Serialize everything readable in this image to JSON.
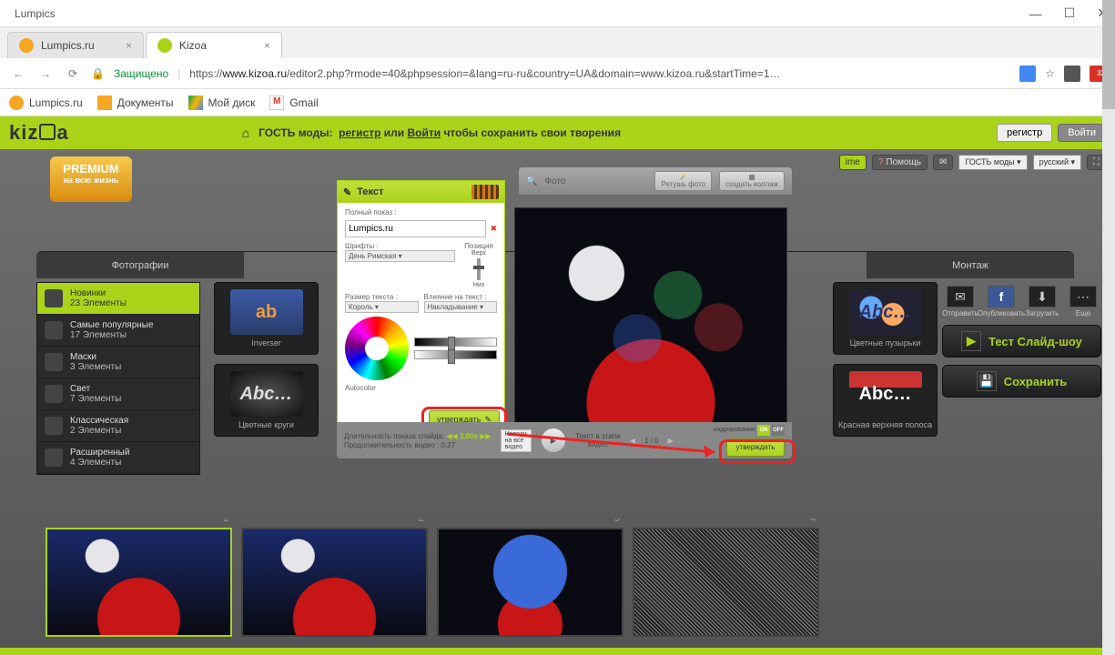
{
  "window": {
    "title": "Lumpics",
    "min": "—",
    "max": "☐",
    "close": "✕"
  },
  "tabs": [
    {
      "label": "Lumpics.ru",
      "active": false
    },
    {
      "label": "Kizoa",
      "active": true
    }
  ],
  "addr": {
    "secure": "Защищено",
    "url_prefix": "https://",
    "url_domain": "www.kizoa.ru",
    "url_rest": "/editor2.php?rmode=40&phpsession=&lang=ru-ru&country=UA&domain=www.kizoa.ru&startTime=1…"
  },
  "bookmarks": [
    {
      "label": "Lumpics.ru",
      "color": "#f5a623"
    },
    {
      "label": "Документы",
      "color": "#f5a623"
    },
    {
      "label": "Мой диск",
      "color": "#0f9d58"
    },
    {
      "label": "Gmail",
      "color": "#d93025"
    }
  ],
  "header": {
    "guest_prefix": "ГОСТЬ моды:",
    "register": "регистр",
    "or": "или",
    "login": "Войти",
    "save_suffix": "чтобы сохранить свои творения",
    "btn_register": "регистр",
    "btn_login": "Войти"
  },
  "premium": {
    "line1": "PREMIUM",
    "line2": "на всю жизнь"
  },
  "top_tools": {
    "help": "Помощь",
    "guest_dd": "ГОСТЬ моды",
    "lang_dd": "русский"
  },
  "main_tabs": {
    "left": "Фотографии",
    "right": "Монтаж"
  },
  "categories": [
    {
      "name": "Новинки",
      "count": "23 Элементы",
      "active": true
    },
    {
      "name": "Самые популярные",
      "count": "17 Элементы"
    },
    {
      "name": "Маски",
      "count": "3 Элементы"
    },
    {
      "name": "Свет",
      "count": "7 Элементы"
    },
    {
      "name": "Классическая",
      "count": "2 Элементы"
    },
    {
      "name": "Расширенный",
      "count": "4 Элементы"
    }
  ],
  "style_thumbs": {
    "inverser": "Inverser",
    "circ": "Цветные круги"
  },
  "style_thumbs_r": {
    "bubbles": "Цветные пузырьки",
    "abc": "Abc…",
    "red_stripe": "Красная верхняя полоса"
  },
  "photo_bar": {
    "label": "Фото",
    "retouch": "Ретушь фото",
    "collage": "создать коллаж"
  },
  "text_panel": {
    "title": "Текст",
    "full_label": "Полный показ :",
    "full_value": "Lumpics.ru",
    "font_label": "Шрифты :",
    "font_value": "День Римская",
    "pos_label": "Позиция",
    "pos_top": "Верх",
    "pos_bottom": "Низ",
    "size_label": "Размер текста :",
    "size_value": "Король",
    "effect_label": "Влияние на текст :",
    "effect_value": "Накладывание",
    "autocolor": "Autocolor",
    "approve": "утверждать"
  },
  "bottom": {
    "dur_label": "Длительность показа слайда:",
    "dur_value": "3.00s",
    "video_dur": "Продолжительность видео : 0:27",
    "apply_all": "Наведи на все видео",
    "stage_text": "Текст в этапа видео",
    "page": "1 / 0",
    "frame_label": "кадрирование",
    "on": "ON",
    "off": "OFF",
    "approve": "утверждать"
  },
  "actions": {
    "send": "Отправить",
    "publish": "Опубликовать",
    "download": "Загрузить",
    "more": "Еще",
    "test": "Тест Слайд-шоу",
    "save": "Сохранить"
  },
  "timeline": [
    1,
    2,
    3,
    4
  ]
}
